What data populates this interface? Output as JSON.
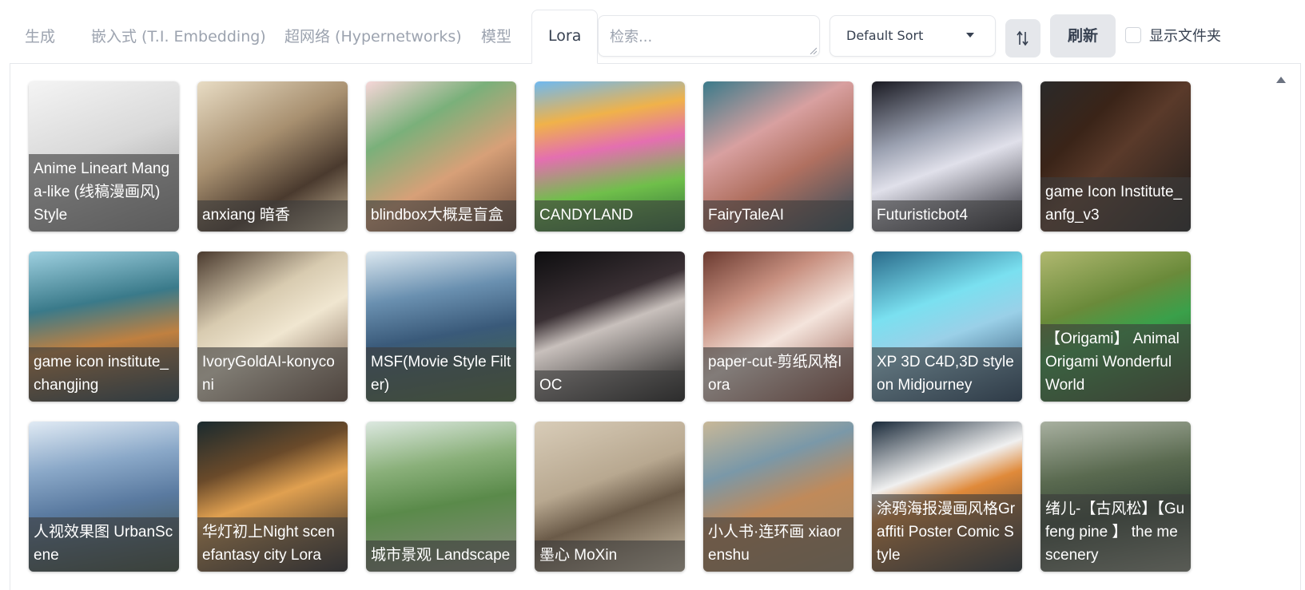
{
  "tabs": [
    {
      "label": "生成",
      "active": false
    },
    {
      "label": "嵌入式 (T.I. Embedding)",
      "active": false
    },
    {
      "label": "超网络 (Hypernetworks)",
      "active": false
    },
    {
      "label": "模型",
      "active": false
    },
    {
      "label": "Lora",
      "active": true
    }
  ],
  "search": {
    "placeholder": "检索...",
    "value": ""
  },
  "sort": {
    "selected": "Default Sort",
    "direction_icon": "sort-arrows-icon"
  },
  "refresh_label": "刷新",
  "show_folders": {
    "label": "显示文件夹",
    "checked": false
  },
  "cards": [
    {
      "name": "Anime Lineart Manga-like (线稿漫画风) Style",
      "bg": "linear-gradient(160deg,#f4f4f4 0%,#d9d9d9 45%,#8f8f8f 100%)"
    },
    {
      "name": "anxiang 暗香",
      "bg": "linear-gradient(150deg,#e8dcc4 0%,#a89070 40%,#4a3a2e 70%,#c9b89a 100%)"
    },
    {
      "name": "blindbox大概是盲盒",
      "bg": "linear-gradient(150deg,#f6d6d8 0%,#7ab07a 30%,#d7a078 60%,#6a4a3a 100%)"
    },
    {
      "name": "CANDYLAND",
      "bg": "linear-gradient(170deg,#6fb9f0 0%,#f0b24a 25%,#e46fb0 45%,#6fbf4a 70%,#2f6b3a 100%)"
    },
    {
      "name": "FairyTaleAI",
      "bg": "linear-gradient(150deg,#3a7a8a 0%,#d8a0a0 35%,#b07060 60%,#2b4a5a 100%)"
    },
    {
      "name": "Futuristicbot4",
      "bg": "linear-gradient(160deg,#1a1a22 0%,#9aa0b0 35%,#e0e0ea 55%,#202028 100%)"
    },
    {
      "name": "game Icon Institute_anfg_v3",
      "bg": "linear-gradient(135deg,#2a2a2a 0%,#3a2418 30%,#5a3a2a 50%,#1c1c1c 100%)"
    },
    {
      "name": "game icon institute_changjing",
      "bg": "linear-gradient(170deg,#9ed0e0 0%,#3a7a8a 35%,#c08040 60%,#1e3a4a 100%)"
    },
    {
      "name": "IvoryGoldAI-konyconi",
      "bg": "linear-gradient(150deg,#4a3a2e 0%,#d8cbb0 35%,#f0e6d0 55%,#6a5040 100%)"
    },
    {
      "name": "MSF(Movie Style Filter)",
      "bg": "linear-gradient(170deg,#dce8f0 0%,#6a90b0 30%,#3a5a7a 55%,#4a6a3a 100%)"
    },
    {
      "name": "OC",
      "bg": "linear-gradient(160deg,#0e0e10 0%,#3a3034 35%,#c8c0bc 50%,#141414 100%)"
    },
    {
      "name": "paper-cut-剪纸风格lora",
      "bg": "linear-gradient(150deg,#6a3a30 0%,#c89080 30%,#f4e4dc 55%,#8a4a3c 100%)"
    },
    {
      "name": "XP 3D C4D,3D style on Midjourney",
      "bg": "linear-gradient(160deg,#2a6a8a 0%,#7ae0f0 35%,#9ad0e8 55%,#1a3a5a 100%)"
    },
    {
      "name": "【Origami】 Animal Origami Wonderful World",
      "bg": "linear-gradient(160deg,#b0b870 0%,#6a8a3a 35%,#3aa04a 55%,#3a4a2a 100%)"
    },
    {
      "name": "人视效果图 UrbanScene",
      "bg": "linear-gradient(170deg,#e0eaf4 0%,#8aa8c8 30%,#5a7aa0 55%,#3a4a3a 100%)"
    },
    {
      "name": "华灯初上Night scenefantasy city Lora",
      "bg": "linear-gradient(160deg,#1a2a2e 0%,#6a4a2a 30%,#e0a050 50%,#1e1e24 100%)"
    },
    {
      "name": "城市景观 Landscape",
      "bg": "linear-gradient(170deg,#dce8e0 0%,#8ab07a 30%,#5a8a4a 55%,#8a8a80 100%)"
    },
    {
      "name": "墨心 MoXin",
      "bg": "linear-gradient(160deg,#d8ccb8 0%,#b8a890 40%,#6a5a48 60%,#cfc2aa 100%)"
    },
    {
      "name": "小人书·连环画 xiaorenshu",
      "bg": "linear-gradient(160deg,#c8b898 0%,#7a98a8 30%,#c08a5a 55%,#a08868 100%)"
    },
    {
      "name": "涂鸦海报漫画风格Graffiti Poster Comic Style",
      "bg": "linear-gradient(160deg,#1a2a3a 0%,#f0f0f0 35%,#e08a3a 50%,#1e2a34 100%)"
    },
    {
      "name": "绪儿-【古风松】【Gufeng pine 】 the me scenery",
      "bg": "linear-gradient(170deg,#a8b0a0 0%,#5a6a50 35%,#3a4a3a 60%,#8a9080 100%)"
    }
  ]
}
